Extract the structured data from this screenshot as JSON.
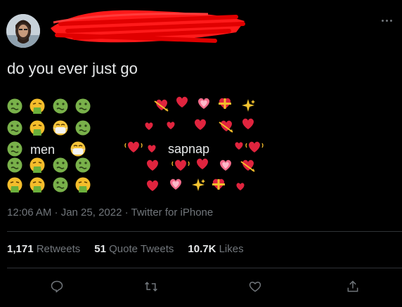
{
  "tweet": {
    "text": "do you ever just go",
    "timestamp": "12:06 AM · Jan 25, 2022 · Twitter for iPhone",
    "emoji_labels": {
      "left_word": "men",
      "right_word": "sapnap"
    },
    "emoji_grid_left": [
      [
        "nauseated-face",
        "vomiting-face",
        "nauseated-face",
        "nauseated-face"
      ],
      [
        "nauseated-face",
        "vomiting-face",
        "mask-face",
        "nauseated-face"
      ],
      [
        "nauseated-face",
        "men",
        "mask-face"
      ],
      [
        "nauseated-face",
        "vomiting-face",
        "nauseated-face",
        "nauseated-face"
      ],
      [
        "vomiting-face",
        "vomiting-face",
        "nauseated-face",
        "vomiting-face"
      ]
    ],
    "emoji_grid_right": [
      "heart-with-arrow",
      "sparkling-heart",
      "growing-heart",
      "heart-with-ribbon",
      "sparkles",
      "red-heart",
      "revolving-hearts",
      "red-heart",
      "heart-with-arrow",
      "sparkling-heart",
      "beating-heart",
      "red-heart",
      "sapnap",
      "red-heart",
      "red-heart",
      "sparkling-heart",
      "red-heart",
      "red-heart",
      "growing-heart",
      "heart-with-arrow",
      "sparkling-heart",
      "growing-heart",
      "sparkles",
      "heart-with-ribbon",
      "red-heart"
    ]
  },
  "stats": {
    "retweets_count": "1,171",
    "retweets_label": "Retweets",
    "quotes_count": "51",
    "quotes_label": "Quote Tweets",
    "likes_count": "10.7K",
    "likes_label": "Likes"
  },
  "icons": {
    "more": "more-dots-icon",
    "reply": "reply-icon",
    "retweet": "retweet-icon",
    "like": "heart-icon",
    "share": "share-icon"
  },
  "colors": {
    "background": "#000000",
    "text": "#e7e9ea",
    "muted": "#71767b",
    "divider": "#2f3336",
    "redaction": "#ff0000",
    "nausea_green": "#79b14a",
    "vomit_yellow": "#f4bd2b",
    "heart_red": "#e0243e",
    "heart_pink": "#f26b8a"
  }
}
